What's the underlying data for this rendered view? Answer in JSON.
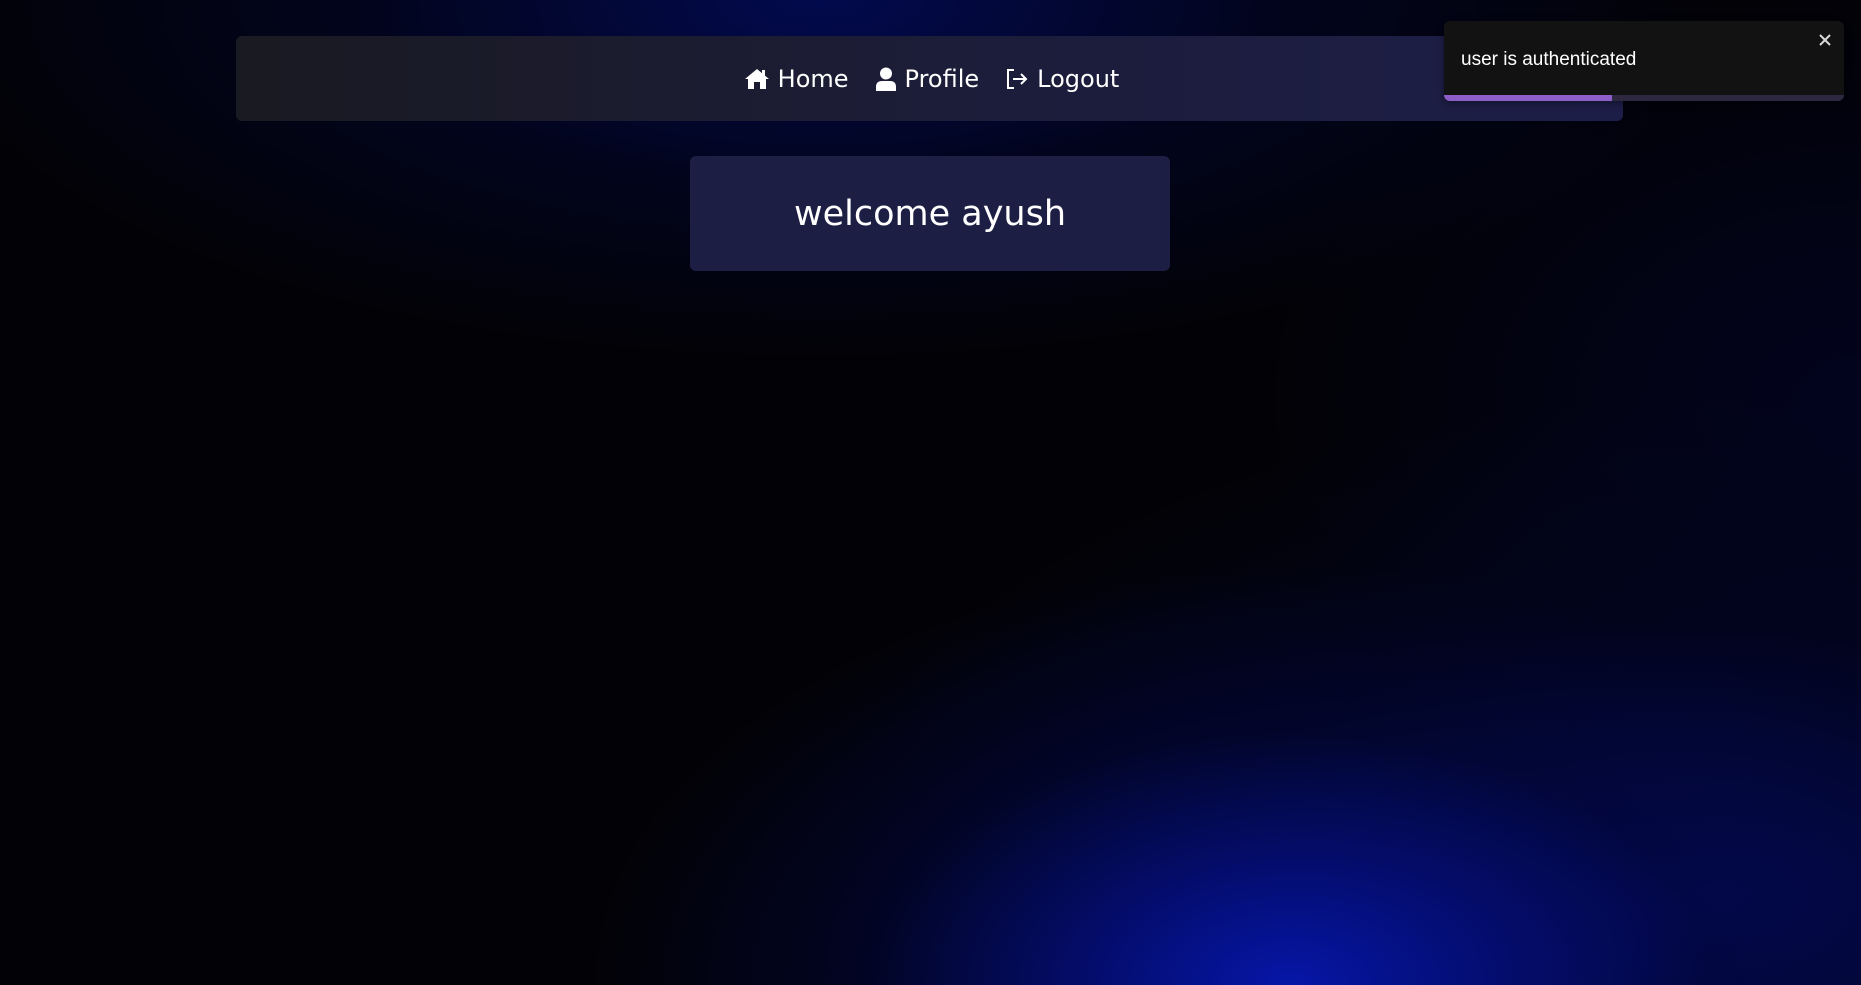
{
  "nav": {
    "items": [
      {
        "label": "Home",
        "icon": "home-icon"
      },
      {
        "label": "Profile",
        "icon": "user-icon"
      },
      {
        "label": "Logout",
        "icon": "logout-icon"
      }
    ]
  },
  "welcome": {
    "text": "welcome ayush"
  },
  "toast": {
    "message": "user is authenticated",
    "close_icon": "close-icon",
    "progress": 0.42,
    "progress_color": "#8d5ec8"
  },
  "colors": {
    "background_accent": "#0616a8",
    "card_background": "#1d1e44",
    "toast_background": "#121212"
  }
}
